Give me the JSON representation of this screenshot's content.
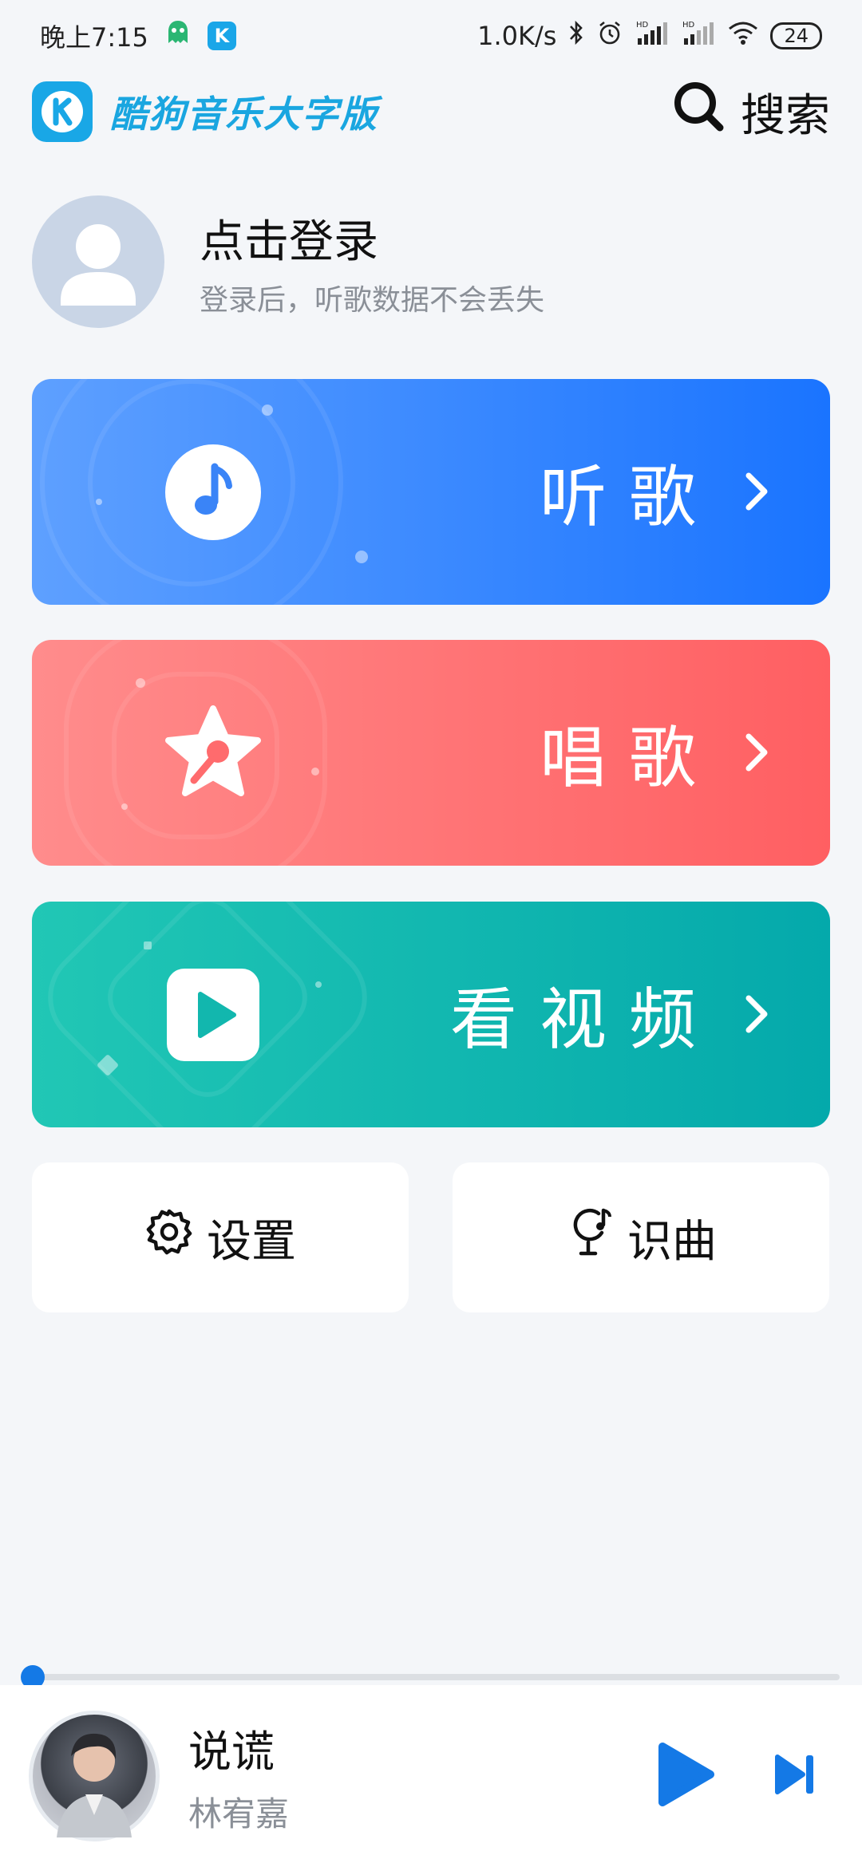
{
  "status_bar": {
    "time": "晚上7:15",
    "net_speed": "1.0K/s",
    "battery": "24",
    "hd1": "HD",
    "hd2": "HD"
  },
  "header": {
    "app_title": "酷狗音乐大字版",
    "search_label": "搜索"
  },
  "profile": {
    "title": "点击登录",
    "subtitle": "登录后，听歌数据不会丢失"
  },
  "cards": {
    "listen": {
      "label": "听歌",
      "color_start": "#5ea0ff",
      "color_end": "#1a74ff"
    },
    "sing": {
      "label": "唱歌",
      "color_start": "#ff8c8c",
      "color_end": "#ff5f62"
    },
    "video": {
      "label": "看视频",
      "color_start": "#21c7b5",
      "color_end": "#04a9ab"
    }
  },
  "buttons": {
    "settings": "设置",
    "recognize": "识曲"
  },
  "player": {
    "song_title": "说谎",
    "artist": "林宥嘉",
    "progress": 0.0,
    "accent": "#1479e6"
  },
  "icons": [
    "ghost-icon",
    "kugou-logo-icon",
    "bluetooth-icon",
    "alarm-icon",
    "signal-icon",
    "wifi-icon",
    "battery-icon",
    "search-icon",
    "user-avatar-icon",
    "music-note-icon",
    "star-microphone-icon",
    "play-square-icon",
    "chevron-right-icon",
    "gear-icon",
    "music-recognition-icon",
    "play-icon",
    "skip-next-icon"
  ]
}
